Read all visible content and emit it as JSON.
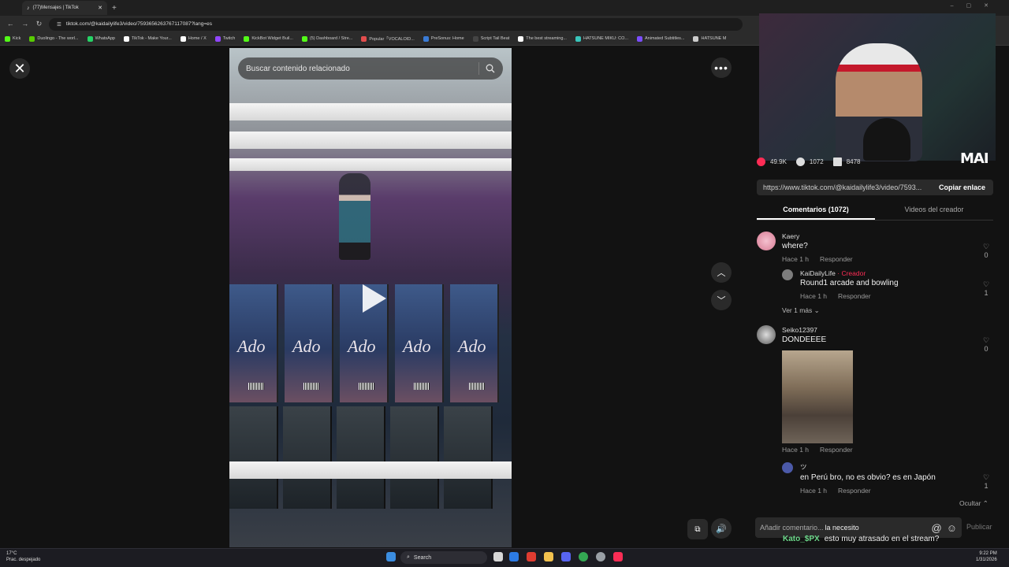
{
  "browser": {
    "tab_title": "(77)Mensajes | TikTok",
    "url": "tiktok.com/@kaidailylife3/video/7593656263767117087?lang=es",
    "bookmarks": [
      {
        "label": "Kick",
        "color": "#53fc18"
      },
      {
        "label": "Duolingo - The worl...",
        "color": "#58cc02"
      },
      {
        "label": "WhatsApp",
        "color": "#25d366"
      },
      {
        "label": "TikTok - Make Your...",
        "color": "#ffffff"
      },
      {
        "label": "Home / X",
        "color": "#ffffff"
      },
      {
        "label": "Twitch",
        "color": "#9146ff"
      },
      {
        "label": "KickBot Widget Buil...",
        "color": "#53fc18"
      },
      {
        "label": "(5) Dashboard / Stre...",
        "color": "#53fc18"
      },
      {
        "label": "Popular「VOCALOID...",
        "color": "#e34d4d"
      },
      {
        "label": "PreSonus: Home",
        "color": "#3a7bd5"
      },
      {
        "label": "Script Tail Beat",
        "color": "#444"
      },
      {
        "label": "The best streaming...",
        "color": "#ffffff"
      },
      {
        "label": "HATSUNE MIKU: CO...",
        "color": "#39c5bb"
      },
      {
        "label": "Animated Subtitles...",
        "color": "#7b4dff"
      },
      {
        "label": "HATSUNE M",
        "color": "#cccccc"
      }
    ]
  },
  "video": {
    "search_placeholder": "Buscar contenido relacionado",
    "box_label": "Ado"
  },
  "stats": {
    "likes": "49.9K",
    "comments": "1072",
    "saves": "8478"
  },
  "share": {
    "link": "https://www.tiktok.com/@kaidailylife3/video/7593...",
    "copy_label": "Copiar enlace"
  },
  "tabs": {
    "comments": "Comentarios (1072)",
    "creator_videos": "Videos del creador"
  },
  "webcam": {
    "logo": "MAI"
  },
  "comments": [
    {
      "user": "Kaery",
      "text": "where?",
      "time": "Hace 1 h",
      "reply": "Responder",
      "likes": "0"
    },
    {
      "user": "KaiDailyLife",
      "badge": "· Creador",
      "text": "Round1 arcade and bowling",
      "time": "Hace 1 h",
      "reply": "Responder",
      "likes": "1"
    },
    {
      "more": "Ver 1 más"
    },
    {
      "user": "Seiko12397",
      "text": "DONDEEEE",
      "time": "Hace 1 h",
      "reply": "Responder",
      "likes": "0"
    },
    {
      "user": "ツ",
      "text": "en Perú bro, no es obvio? es en Japón",
      "time": "Hace 1 h",
      "reply": "Responder",
      "likes": "1"
    }
  ],
  "hide_label": "Ocultar",
  "input": {
    "placeholder": "Añadir comentario...",
    "typed": "la necesito",
    "publish": "Publicar"
  },
  "chat_overlay": {
    "name": "Kato_$PX",
    "text": "esto muy atrasado en el stream?"
  },
  "taskbar": {
    "temp": "17°C",
    "weather": "Prac. despejado",
    "search": "Search",
    "time": "9:22 PM",
    "date": "1/31/2026"
  }
}
